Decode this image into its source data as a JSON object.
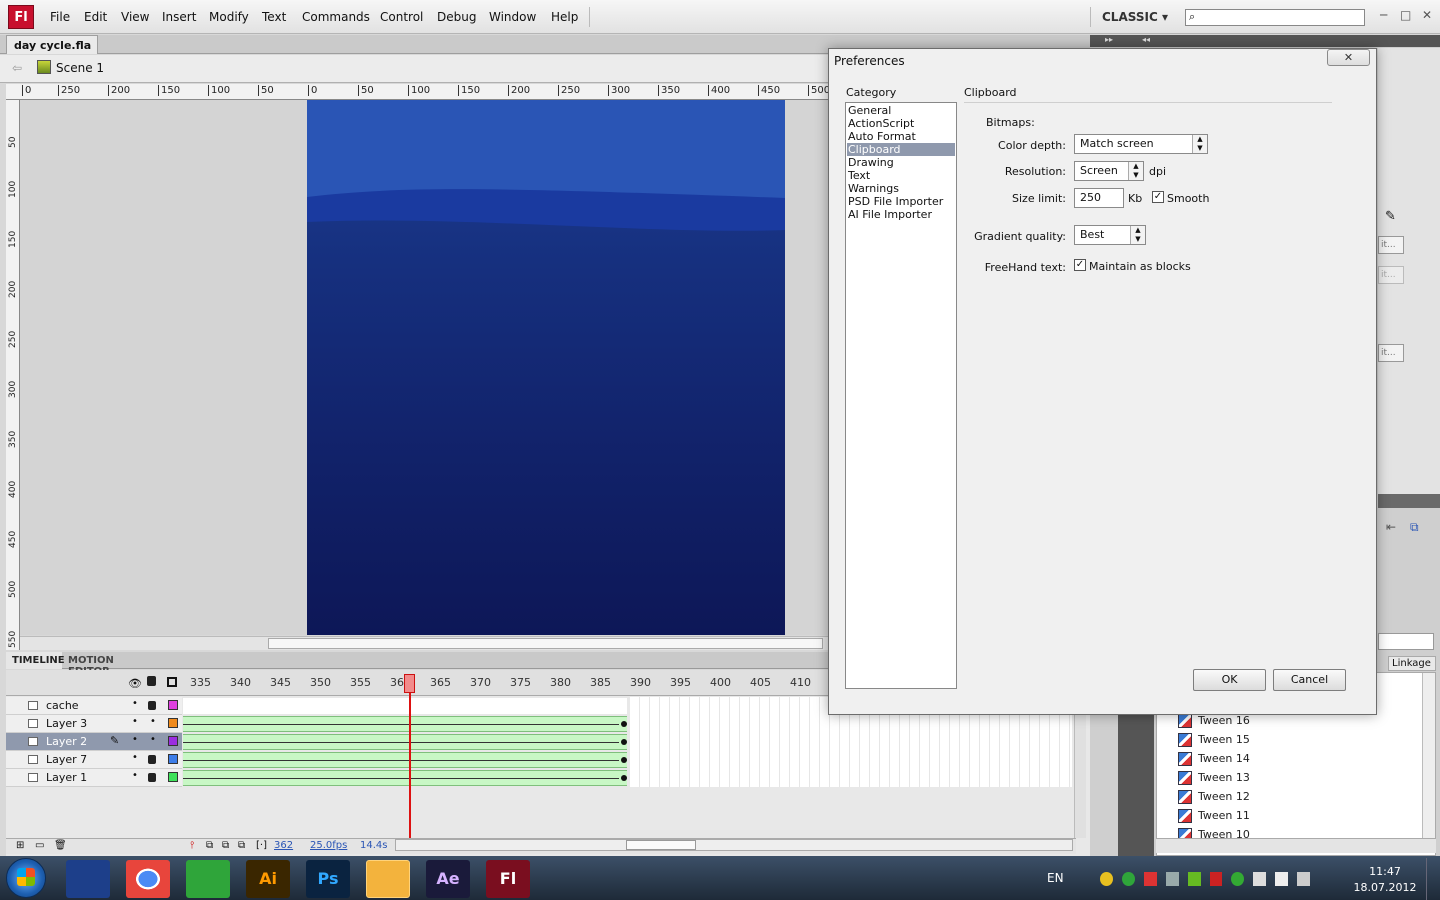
{
  "app": {
    "logo": "Fl",
    "menu": [
      "File",
      "Edit",
      "View",
      "Insert",
      "Modify",
      "Text",
      "Commands",
      "Control",
      "Debug",
      "Window",
      "Help"
    ],
    "workspace": "CLASSIC",
    "window_controls": [
      "─",
      "□",
      "✕"
    ]
  },
  "doc": {
    "tab_label": "day cycle.fla",
    "tab_close": "✕",
    "scene": "Scene 1"
  },
  "rulers": {
    "top": [
      "0",
      "250",
      "200",
      "150",
      "100",
      "50",
      "0",
      "50",
      "100",
      "150",
      "200",
      "250",
      "300",
      "350",
      "400",
      "450",
      "500"
    ],
    "left": [
      "50",
      "100",
      "150",
      "200",
      "250",
      "300",
      "350",
      "400",
      "450",
      "500",
      "550"
    ]
  },
  "timeline": {
    "tabs": [
      "TIMELINE",
      "MOTION EDITOR"
    ],
    "frame_numbers": [
      "335",
      "340",
      "345",
      "350",
      "355",
      "360",
      "365",
      "370",
      "375",
      "380",
      "385",
      "390",
      "395",
      "400",
      "405",
      "410"
    ],
    "layers": [
      {
        "name": "cache",
        "color": "#e040e0"
      },
      {
        "name": "Layer 3",
        "color": "#f08a1c"
      },
      {
        "name": "Layer 2",
        "color": "#9b2de0"
      },
      {
        "name": "Layer 7",
        "color": "#3d7de8"
      },
      {
        "name": "Layer 1",
        "color": "#3ee25a"
      }
    ],
    "current_frame": "362",
    "fps": "25.0fps",
    "time": "14.4s"
  },
  "library": {
    "column": "Linkage",
    "items": [
      "Tween 16",
      "Tween 15",
      "Tween 14",
      "Tween 13",
      "Tween 12",
      "Tween 11",
      "Tween 10"
    ]
  },
  "dialog": {
    "title": "Preferences",
    "close": "✕",
    "category_label": "Category",
    "categories": [
      "General",
      "ActionScript",
      "Auto Format",
      "Clipboard",
      "Drawing",
      "Text",
      "Warnings",
      "PSD File Importer",
      "AI File Importer"
    ],
    "selected": "Clipboard",
    "section_title": "Clipboard",
    "bitmaps_label": "Bitmaps:",
    "color_depth_label": "Color depth:",
    "color_depth_value": "Match screen",
    "resolution_label": "Resolution:",
    "resolution_value": "Screen",
    "resolution_unit": "dpi",
    "size_limit_label": "Size limit:",
    "size_limit_value": "250",
    "size_limit_unit": "Kb",
    "smooth_label": "Smooth",
    "gradient_label": "Gradient quality:",
    "gradient_value": "Best",
    "freehand_label": "FreeHand text:",
    "freehand_check_label": "Maintain as blocks",
    "ok": "OK",
    "cancel": "Cancel"
  },
  "taskbar": {
    "apps": [
      "",
      "",
      "",
      "",
      "Ai",
      "Ps",
      "",
      "Ae",
      "Fl"
    ],
    "lang": "EN",
    "clock_time": "11:47",
    "clock_date": "18.07.2012"
  }
}
